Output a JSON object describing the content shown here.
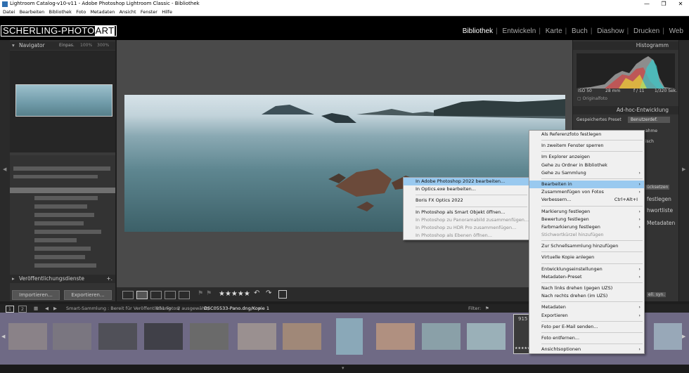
{
  "window": {
    "title": "Lightroom Catalog-v10-v11 - Adobe Photoshop Lightroom Classic - Bibliothek",
    "minimize": "—",
    "maximize": "❐",
    "close": "✕"
  },
  "menubar": [
    "Datei",
    "Bearbeiten",
    "Bibliothek",
    "Foto",
    "Metadaten",
    "Ansicht",
    "Fenster",
    "Hilfe"
  ],
  "logo": {
    "main": "SCHERLING-PHOTO",
    "accent": "ART"
  },
  "modules": [
    "Bibliothek",
    "Entwickeln",
    "Karte",
    "Buch",
    "Diashow",
    "Drucken",
    "Web"
  ],
  "active_module": "Bibliothek",
  "left_panel": {
    "navigator": {
      "title": "Navigator",
      "zoom_fit": "Einpas.",
      "zoom_100": "100%",
      "zoom_300": "300%"
    },
    "collapse_arrow": "◀",
    "publish": "Veröffentlichungsdienste",
    "publish_add": "+.",
    "import_button": "Importieren...",
    "export_button": "Exportieren..."
  },
  "right_panel": {
    "histogram": "Histogramm",
    "hist_iso": "ISO 50",
    "hist_mm": "28 mm",
    "hist_f": "f / 11",
    "hist_sec": "1/320 Sek.",
    "original": "Originalfoto",
    "quick_develop": "Ad-hoc-Entwicklung",
    "saved_preset_label": "Gespeichertes Preset",
    "saved_preset_value": "Benutzerdef.",
    "partial_1": "ahme",
    "partial_2": "isch",
    "partial_3": "ücksetzen",
    "partial_keywords": "festlegen",
    "partial_keywordlist": "hwortliste",
    "partial_metadata": "Metadaten",
    "partial_sync": "ell. syn."
  },
  "toolbar": {
    "stars": "★★★★★"
  },
  "filmstrip_bar": {
    "page1": "1",
    "page2": "2",
    "source": "Smart-Sammlung : Bereit für Veröffentlichung",
    "count": "951 Fotos/",
    "selected": "1 ausgewählt/",
    "file": "DSC05533-Pano.dng/Kopie 1",
    "filter_label": "Filter:"
  },
  "film_label": "915",
  "film_stars": "★★★★★",
  "photoshop_menu": [
    {
      "label": "In Adobe Photoshop 2022 bearbeiten...",
      "highlight": true
    },
    {
      "label": "In Optics.exe bearbeiten..."
    },
    {
      "sep": true
    },
    {
      "label": "Boris FX Optics 2022"
    },
    {
      "sep": true
    },
    {
      "label": "In Photoshop als Smart Objekt öffnen..."
    },
    {
      "label": "In Photoshop zu Panoramabild zusammenfügen...",
      "disabled": true
    },
    {
      "label": "In Photoshop zu HDR Pro zusammenfügen...",
      "disabled": true
    },
    {
      "label": "In Photoshop als Ebenen öffnen...",
      "disabled": true
    }
  ],
  "context_menu": [
    {
      "label": "Als Referenzfoto festlegen"
    },
    {
      "sep": true
    },
    {
      "label": "In zweitem Fenster sperren"
    },
    {
      "sep": true
    },
    {
      "label": "Im Explorer anzeigen"
    },
    {
      "label": "Gehe zu Ordner in Bibliothek"
    },
    {
      "label": "Gehe zu Sammlung",
      "arrow": "›"
    },
    {
      "sep": true
    },
    {
      "label": "Bearbeiten in",
      "arrow": "›",
      "highlight": true
    },
    {
      "label": "Zusammenfügen von Fotos",
      "arrow": "›"
    },
    {
      "label": "Verbessern...",
      "shortcut": "Ctrl+Alt+I"
    },
    {
      "sep": true
    },
    {
      "label": "Markierung festlegen",
      "arrow": "›"
    },
    {
      "label": "Bewertung festlegen",
      "arrow": "›"
    },
    {
      "label": "Farbmarkierung festlegen",
      "arrow": "›"
    },
    {
      "label": "Stichwortkürzel hinzufügen",
      "disabled": true
    },
    {
      "sep": true
    },
    {
      "label": "Zur Schnellsammlung hinzufügen"
    },
    {
      "sep": true
    },
    {
      "label": "Virtuelle Kopie anlegen"
    },
    {
      "sep": true
    },
    {
      "label": "Entwicklungseinstellungen",
      "arrow": "›"
    },
    {
      "label": "Metadaten-Preset",
      "arrow": "›"
    },
    {
      "sep": true
    },
    {
      "label": "Nach links drehen (gegen UZS)"
    },
    {
      "label": "Nach rechts drehen (im UZS)"
    },
    {
      "sep": true
    },
    {
      "label": "Metadaten",
      "arrow": "›"
    },
    {
      "label": "Exportieren",
      "arrow": "›"
    },
    {
      "sep": true
    },
    {
      "label": "Foto per E-Mail senden..."
    },
    {
      "sep": true
    },
    {
      "label": "Foto entfernen..."
    },
    {
      "sep": true
    },
    {
      "label": "Ansichtsoptionen",
      "arrow": "›"
    }
  ]
}
